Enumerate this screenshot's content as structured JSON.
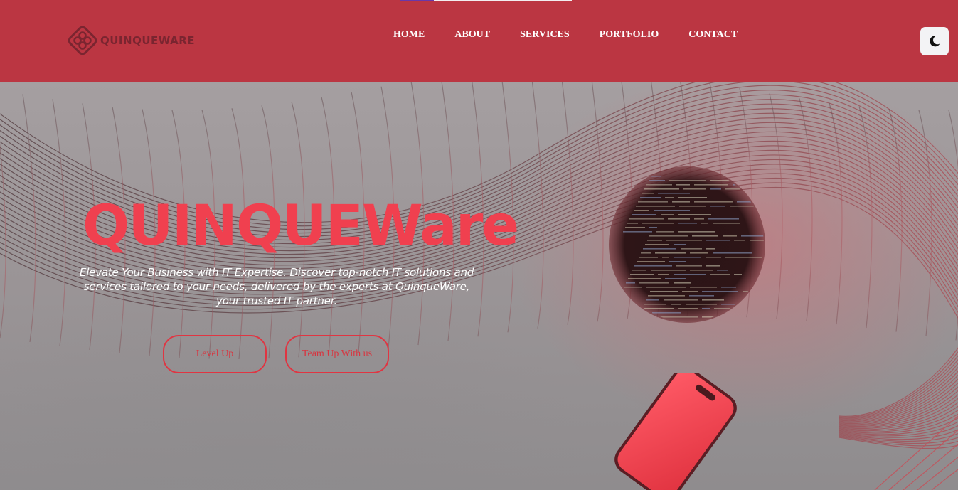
{
  "page": {
    "scroll_progress": 0.2
  },
  "brand": {
    "name": "QUINQUEWARE",
    "logo_icon": "quinqueware-logo-icon"
  },
  "nav": {
    "items": [
      {
        "label": "HOME"
      },
      {
        "label": "ABOUT"
      },
      {
        "label": "SERVICES"
      },
      {
        "label": "PORTFOLIO"
      },
      {
        "label": "CONTACT"
      }
    ],
    "theme_toggle_icon": "moon-icon"
  },
  "hero": {
    "title": "QUINQUEWare",
    "description": "Elevate Your Business with IT Expertise. Discover top-notch IT solutions and services tailored to your needs, delivered by the experts at QuinqueWare, your trusted IT partner.",
    "buttons": {
      "level_up": "Level Up",
      "team_up": "Team Up With us"
    },
    "decor_icons": [
      "wire-mesh-wave",
      "code-sphere-icon",
      "smartphone-icon"
    ]
  },
  "colors": {
    "navbar": "#bb3642",
    "accent": "#f0404f",
    "button_border": "#e03542",
    "progress": "#6a38a8",
    "hero_bg": "#8f8c8e"
  }
}
